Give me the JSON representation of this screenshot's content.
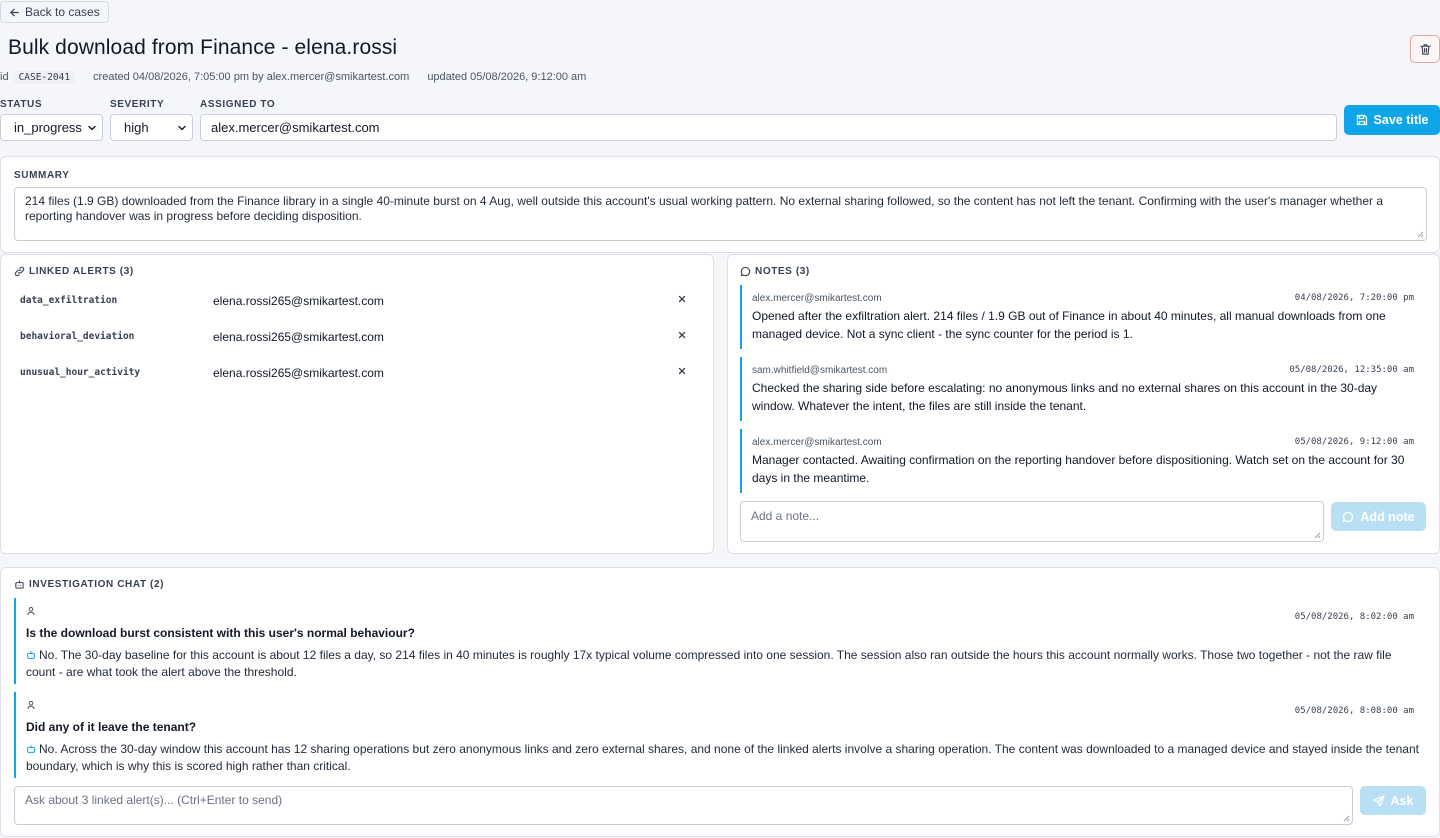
{
  "header": {
    "back_label": "Back to cases",
    "title": "Bulk download from Finance - elena.rossi",
    "id_label": "id",
    "case_id": "CASE-2041",
    "created": "created 04/08/2026, 7:05:00 pm by alex.mercer@smikartest.com",
    "updated": "updated 05/08/2026, 9:12:00 am"
  },
  "fields": {
    "status_label": "STATUS",
    "status_value": "in_progress",
    "severity_label": "SEVERITY",
    "severity_value": "high",
    "assigned_label": "ASSIGNED TO",
    "assigned_value": "alex.mercer@smikartest.com",
    "save_label": "Save title"
  },
  "summary": {
    "label": "SUMMARY",
    "text": "214 files (1.9 GB) downloaded from the Finance library in a single 40-minute burst on 4 Aug, well outside this account's usual working pattern. No external sharing followed, so the content has not left the tenant. Confirming with the user's manager whether a reporting handover was in progress before deciding disposition."
  },
  "linked_alerts": {
    "label": "LINKED ALERTS (3)",
    "items": [
      {
        "type": "data_exfiltration",
        "user": "elena.rossi265@smikartest.com"
      },
      {
        "type": "behavioral_deviation",
        "user": "elena.rossi265@smikartest.com"
      },
      {
        "type": "unusual_hour_activity",
        "user": "elena.rossi265@smikartest.com"
      }
    ]
  },
  "notes": {
    "label": "NOTES (3)",
    "items": [
      {
        "author": "alex.mercer@smikartest.com",
        "timestamp": "04/08/2026, 7:20:00 pm",
        "body": "Opened after the exfiltration alert. 214 files / 1.9 GB out of Finance in about 40 minutes, all manual downloads from one managed device. Not a sync client - the sync counter for the period is 1."
      },
      {
        "author": "sam.whitfield@smikartest.com",
        "timestamp": "05/08/2026, 12:35:00 am",
        "body": "Checked the sharing side before escalating: no anonymous links and no external shares on this account in the 30-day window. Whatever the intent, the files are still inside the tenant."
      },
      {
        "author": "alex.mercer@smikartest.com",
        "timestamp": "05/08/2026, 9:12:00 am",
        "body": "Manager contacted. Awaiting confirmation on the reporting handover before dispositioning. Watch set on the account for 30 days in the meantime."
      }
    ],
    "input_placeholder": "Add a note...",
    "add_label": "Add note"
  },
  "chat": {
    "label": "INVESTIGATION CHAT (2)",
    "items": [
      {
        "timestamp": "05/08/2026, 8:02:00 am",
        "question": "Is the download burst consistent with this user's normal behaviour?",
        "answer": "No. The 30-day baseline for this account is about 12 files a day, so 214 files in 40 minutes is roughly 17x typical volume compressed into one session. The session also ran outside the hours this account normally works. Those two together - not the raw file count - are what took the alert above the threshold."
      },
      {
        "timestamp": "05/08/2026, 8:08:00 am",
        "question": "Did any of it leave the tenant?",
        "answer": "No. Across the 30-day window this account has 12 sharing operations but zero anonymous links and zero external shares, and none of the linked alerts involve a sharing operation. The content was downloaded to a managed device and stayed inside the tenant boundary, which is why this is scored high rather than critical."
      }
    ],
    "input_placeholder": "Ask about 3 linked alert(s)... (Ctrl+Enter to send)",
    "ask_label": "Ask"
  },
  "colors": {
    "accent": "#0ea5e9",
    "accent_disabled": "#b8dff3",
    "danger_border": "#e8a3a3"
  }
}
